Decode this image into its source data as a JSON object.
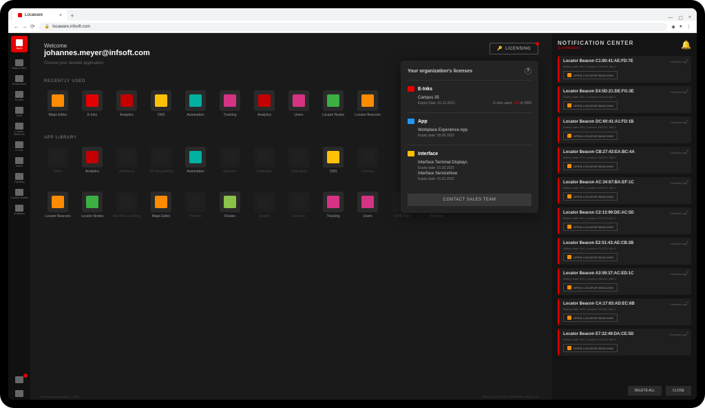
{
  "browser": {
    "tab_title": "Locaware",
    "url": "locaware.infsoft.com"
  },
  "sidebar": {
    "app_label": "Apps",
    "items": [
      {
        "label": "Maps Editor"
      },
      {
        "label": "Automation"
      },
      {
        "label": "Routes"
      },
      {
        "label": "CMS"
      },
      {
        "label": "Locator Beacons"
      },
      {
        "label": "E-Inks"
      },
      {
        "label": "Users"
      },
      {
        "label": "Tracking"
      },
      {
        "label": "Locator Nodes"
      },
      {
        "label": "Analytics"
      }
    ]
  },
  "header": {
    "welcome": "Welcome",
    "email": "johannes.meyer@infsoft.com",
    "subtitle": "Choose your desired application:",
    "licensing_btn": "LICENSING"
  },
  "sections": {
    "recent_title": "RECENTLY USED",
    "library_title": "APP LIBRARY"
  },
  "recent_apps": [
    {
      "label": "Maps Editor",
      "color": "c-orange"
    },
    {
      "label": "E-Inks",
      "color": "c-red"
    },
    {
      "label": "Analytics",
      "color": "c-redalt"
    },
    {
      "label": "CMS",
      "color": "c-yellow"
    },
    {
      "label": "Automation",
      "color": "c-teal"
    },
    {
      "label": "Tracking",
      "color": "c-magenta"
    },
    {
      "label": "Analytics",
      "color": "c-redalt"
    },
    {
      "label": "Users",
      "color": "c-magenta"
    },
    {
      "label": "Locator Nodes",
      "color": "c-green"
    },
    {
      "label": "Locator Beacons",
      "color": "c-orange"
    }
  ],
  "library_apps_row1": [
    {
      "label": "Alarm",
      "color": "c-dark",
      "dim": true
    },
    {
      "label": "Analytics",
      "color": "c-redalt"
    },
    {
      "label": "Antibacon",
      "color": "c-dark",
      "dim": true
    },
    {
      "label": "AR Wayguiding",
      "color": "c-dark",
      "dim": true
    },
    {
      "label": "Automation",
      "color": "c-teal"
    },
    {
      "label": "Beacons",
      "color": "c-dark",
      "dim": true
    },
    {
      "label": "Calibration",
      "color": "c-dark",
      "dim": true
    },
    {
      "label": "Calibrating",
      "color": "c-dark",
      "dim": true
    },
    {
      "label": "CMS",
      "color": "c-yellow"
    },
    {
      "label": "Devices",
      "color": "c-dark",
      "dim": true
    }
  ],
  "library_apps_row2": [
    {
      "label": "Locator Beacons",
      "color": "c-orange"
    },
    {
      "label": "Locator Nodes",
      "color": "c-green"
    },
    {
      "label": "Machine Learning",
      "color": "c-dark",
      "dim": true
    },
    {
      "label": "Maps Editor",
      "color": "c-orange"
    },
    {
      "label": "Planner",
      "color": "c-dark",
      "dim": true
    },
    {
      "label": "Routes",
      "color": "c-lime"
    },
    {
      "label": "Search",
      "color": "c-dark",
      "dim": true
    },
    {
      "label": "Sensors",
      "color": "c-dark",
      "dim": true
    },
    {
      "label": "Tracking",
      "color": "c-magenta"
    },
    {
      "label": "Users",
      "color": "c-magenta"
    },
    {
      "label": "UWB Tags",
      "color": "c-dark",
      "dim": true
    },
    {
      "label": "Workflow",
      "color": "c-dark",
      "dim": true
    }
  ],
  "licenses": {
    "title": "Your organization's licenses",
    "einks": {
      "header": "E-Inks",
      "campus_name": "Campus 35",
      "expiry_label": "Expiry Date:",
      "expiry": "31.12.2021",
      "used_label": "E-Inks used:",
      "used": "120",
      "of": "of",
      "total": "2000"
    },
    "app": {
      "header": "App",
      "name": "Workplace Experience App",
      "expiry_label": "Expiry date:",
      "expiry": "30.06.2022"
    },
    "interface": {
      "header": "Interface",
      "item1": "Interface Terminal Displays",
      "item1_exp_label": "Expiry date:",
      "item1_exp": "01.03.2022",
      "item2": "Interface ServiceNow",
      "item2_exp_label": "Expiry date:",
      "item2_exp": "01.01.2022"
    },
    "sales_btn": "CONTACT SALES TEAM"
  },
  "notifications": {
    "title": "NOTIFICATION CENTER",
    "count_label": "11 notifications",
    "open_btn": "OPEN LOCATOR BEACONS",
    "delete_all": "DELETE ALL",
    "close": "CLOSE",
    "items": [
      {
        "name": "Locator Beacon C1:80:41:AE:FD:7E",
        "meta": "Battery state 30%, Location: INS223, Mfd 4",
        "time": "3 minutes ago"
      },
      {
        "name": "Locator Beacon E4:5D:21:DE:FG:3E",
        "meta": "Battery state 25%, Location: RO333, Mfd 4",
        "time": "3 minutes ago"
      },
      {
        "name": "Locator Beacon DC:60:41:A1:FD:1B",
        "meta": "Battery state 30%, Location: INS223, Mfd 4",
        "time": "3 minutes ago"
      },
      {
        "name": "Locator Beacon CB:27:43:EA:BC:4A",
        "meta": "Battery state 27%, Location: INS223, Mfd 2",
        "time": "3 minutes ago"
      },
      {
        "name": "Locator Beacon AC:34:67:BA:EF:1C",
        "meta": "Battery state 29%, Location: INS223, Mfd 4",
        "time": "3 minutes ago"
      },
      {
        "name": "Locator Beacon C2:13:99:DE:AC:5D",
        "meta": "Battery state 26%, Location: RO333, Mfd 2",
        "time": "3 minutes ago"
      },
      {
        "name": "Locator Beacon E2:51:43:AE:CB:2B",
        "meta": "Battery state 25%, Location: RO333, Mfd 4",
        "time": "3 minutes ago"
      },
      {
        "name": "Locator Beacon A3:59:37:AC:ED:1C",
        "meta": "Battery state 29%, Location: INS224, Mfd 4",
        "time": "3 minutes ago"
      },
      {
        "name": "Locator Beacon CA:17:63:AD:EC:6B",
        "meta": "Battery state 40%, Location: RO333, Mfd 2",
        "time": "3 minutes ago"
      },
      {
        "name": "Locator Beacon E7:22:49:DA:CE:5D",
        "meta": "Battery state 29%, Location: INS224, Mfd 4",
        "time": "3 minutes ago"
      }
    ]
  },
  "footer": {
    "left": "infsoft locaware platform – 2021",
    "right": "Version 1.2.34, Build d23d29e0lex, Region EU"
  }
}
